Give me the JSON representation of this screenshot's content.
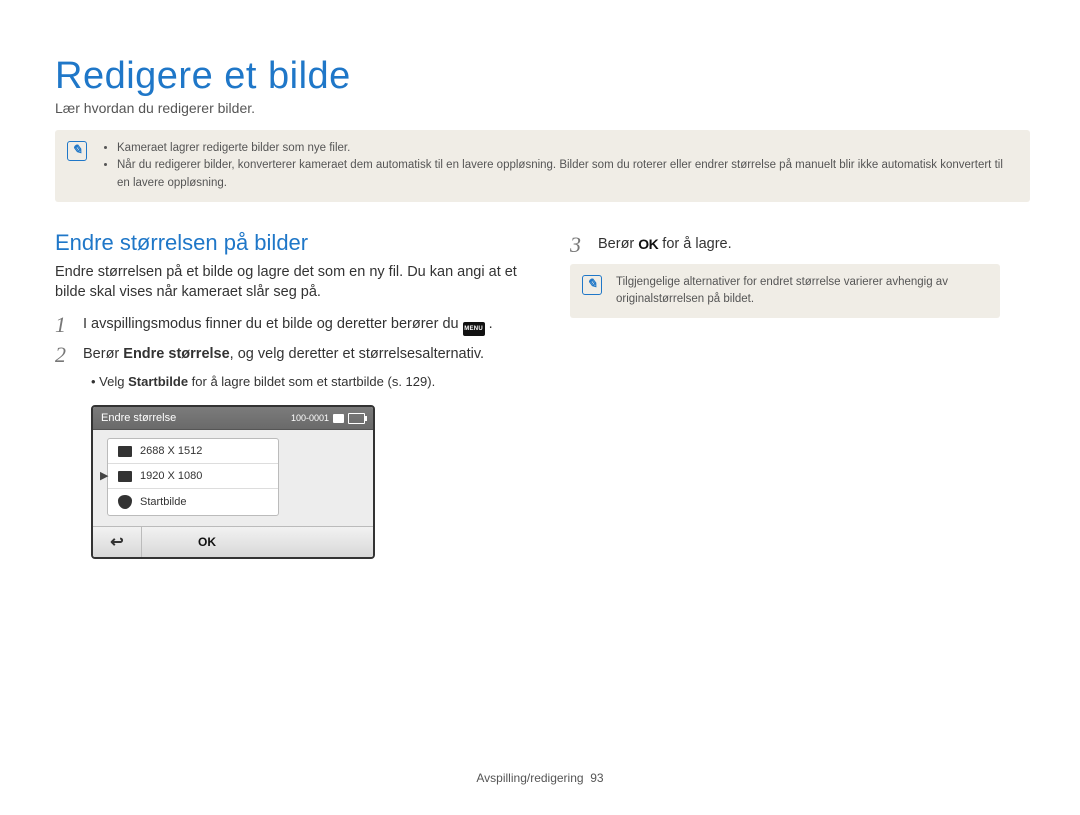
{
  "title": "Redigere et bilde",
  "subtitle": "Lær hvordan du redigerer bilder.",
  "top_note": {
    "bullets": [
      "Kameraet lagrer redigerte bilder som nye filer.",
      "Når du redigerer bilder, konverterer kameraet dem automatisk til en lavere oppløsning. Bilder som du roterer eller endrer størrelse på manuelt blir ikke automatisk konvertert til en lavere oppløsning."
    ]
  },
  "left": {
    "section_title": "Endre størrelsen på bilder",
    "section_desc": "Endre størrelsen på et bilde og lagre det som en ny fil. Du kan angi at et bilde skal vises når kameraet slår seg på.",
    "step1_num": "1",
    "step1_prefix": "I avspillingsmodus finner du et bilde og deretter berører du ",
    "step1_menu": "MENU",
    "step1_suffix": " .",
    "step2_num": "2",
    "step2_prefix": "Berør ",
    "step2_bold": "Endre størrelse",
    "step2_suffix1": ", og velg deretter et størrelsesalternativ.",
    "step2_sub_prefix": "Velg ",
    "step2_sub_bold": "Startbilde",
    "step2_sub_suffix": " for å lagre bildet som et startbilde (s. 129).",
    "screen": {
      "header": "Endre størrelse",
      "counter": "100-0001",
      "options": [
        "2688 X 1512",
        "1920 X 1080",
        "Startbilde"
      ],
      "ok": "OK",
      "selected_index": 1
    }
  },
  "right": {
    "step3_num": "3",
    "step3_prefix": "Berør ",
    "step3_suffix": " for å lagre.",
    "note": "Tilgjengelige alternativer for endret størrelse varierer avhengig av originalstørrelsen på bildet."
  },
  "footer": {
    "section": "Avspilling/redigering",
    "page": "93"
  }
}
